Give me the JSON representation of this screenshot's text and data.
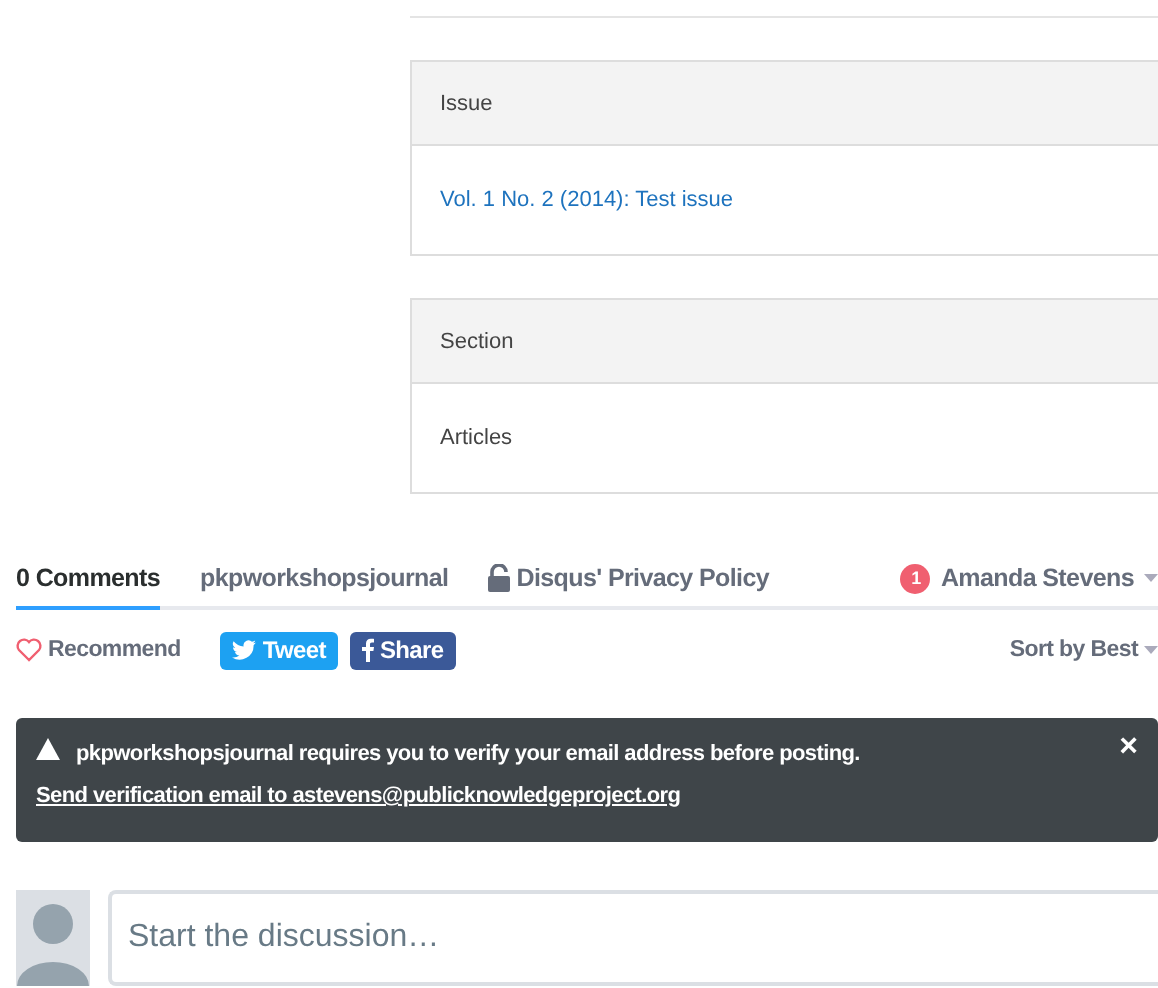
{
  "panels": [
    {
      "heading": "Issue",
      "value": "Vol. 1 No. 2 (2014): Test issue",
      "kind": "link"
    },
    {
      "heading": "Section",
      "value": "Articles",
      "kind": "text"
    }
  ],
  "comments": {
    "tabs": [
      {
        "label": "0 Comments",
        "selected": true
      },
      {
        "label": "pkpworkshopsjournal",
        "selected": false
      }
    ],
    "privacy": "Disqus' Privacy Policy",
    "notifications": "1",
    "user": "Amanda Stevens",
    "recommend": "Recommend",
    "tweet": "Tweet",
    "share": "Share",
    "sort": "Sort by Best",
    "alert": {
      "message": "pkpworkshopsjournal requires you to verify your email address before posting.",
      "link": "Send verification email to astevens@publicknowledgeproject.org",
      "close": "×"
    },
    "composer": {
      "placeholder": "Start the discussion…"
    }
  }
}
